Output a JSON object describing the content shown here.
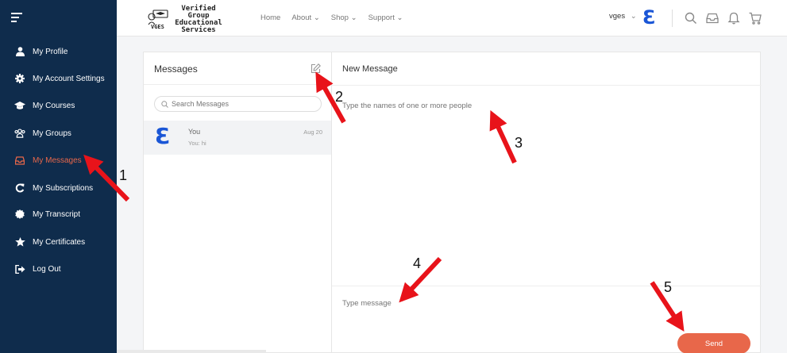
{
  "sidebar": {
    "items": [
      {
        "label": "My Profile",
        "icon": "user-icon"
      },
      {
        "label": "My Account Settings",
        "icon": "gear-icon"
      },
      {
        "label": "My Courses",
        "icon": "graduation-cap-icon"
      },
      {
        "label": "My Groups",
        "icon": "group-icon"
      },
      {
        "label": "My Messages",
        "icon": "inbox-icon",
        "active": true
      },
      {
        "label": "My Subscriptions",
        "icon": "refresh-icon"
      },
      {
        "label": "My Transcript",
        "icon": "badge-icon"
      },
      {
        "label": "My Certificates",
        "icon": "star-icon"
      },
      {
        "label": "Log Out",
        "icon": "logout-icon"
      }
    ]
  },
  "header": {
    "logo_text_1": "Verified Group",
    "logo_text_2": "Educational",
    "logo_text_3": "Services",
    "logo_abbr": "VGES",
    "nav": {
      "home": "Home",
      "about": "About",
      "shop": "Shop",
      "support": "Support"
    },
    "user": "vges",
    "brand_letter": "Ɛ"
  },
  "messages": {
    "title": "Messages",
    "search_placeholder": "Search Messages",
    "conversations": [
      {
        "avatar": "Ɛ",
        "name": "You",
        "preview": "You: hi",
        "date": "Aug 20"
      }
    ]
  },
  "new_message": {
    "title": "New Message",
    "to_placeholder": "Type the names of one or more people",
    "message_placeholder": "Type message",
    "send_label": "Send"
  },
  "annotations": [
    "1",
    "2",
    "3",
    "4",
    "5"
  ],
  "colors": {
    "sidebar": "#0f2c4c",
    "accent": "#e8674a",
    "brand": "#1a56d6",
    "arrow": "#e8131a"
  }
}
